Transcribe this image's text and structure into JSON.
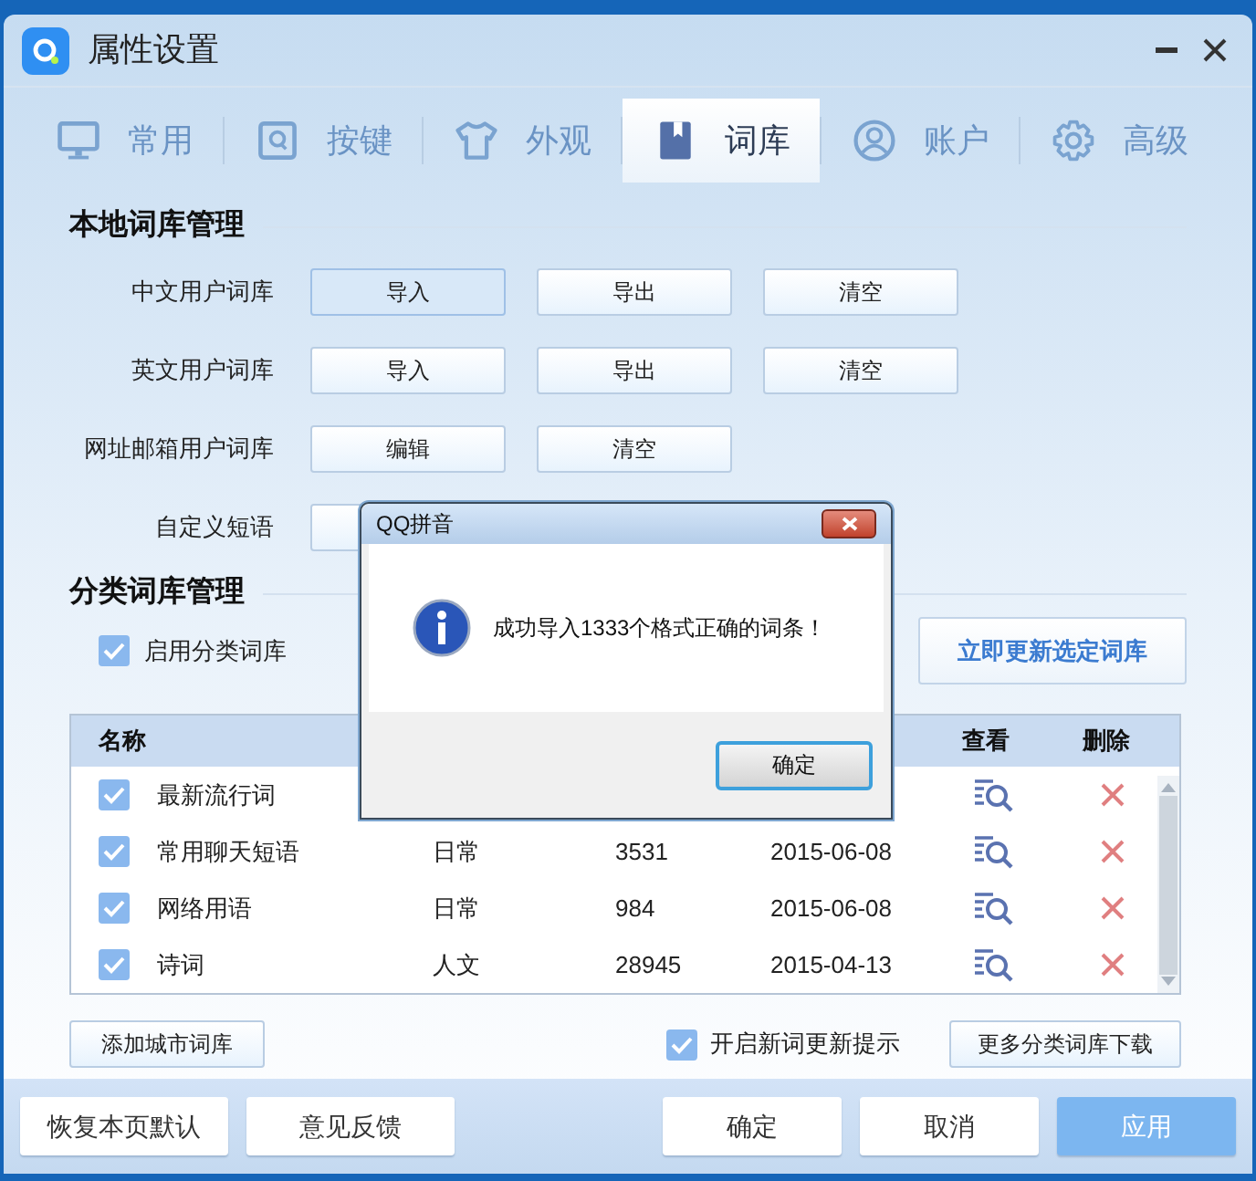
{
  "window": {
    "title": "属性设置"
  },
  "tabs": [
    {
      "label": "常用",
      "selected": false
    },
    {
      "label": "按键",
      "selected": false
    },
    {
      "label": "外观",
      "selected": false
    },
    {
      "label": "词库",
      "selected": true
    },
    {
      "label": "账户",
      "selected": false
    },
    {
      "label": "高级",
      "selected": false
    }
  ],
  "local_dictionaries": {
    "title": "本地词库管理",
    "rows": [
      {
        "label": "中文用户词库",
        "buttons": [
          {
            "label": "导入",
            "selected": true
          },
          {
            "label": "导出",
            "selected": false
          },
          {
            "label": "清空",
            "selected": false
          }
        ]
      },
      {
        "label": "英文用户词库",
        "buttons": [
          {
            "label": "导入",
            "selected": false
          },
          {
            "label": "导出",
            "selected": false
          },
          {
            "label": "清空",
            "selected": false
          }
        ]
      },
      {
        "label": "网址邮箱用户词库",
        "buttons": [
          {
            "label": "编辑",
            "selected": false
          },
          {
            "label": "清空",
            "selected": false
          }
        ]
      },
      {
        "label": "自定义短语",
        "covered_button": true
      }
    ]
  },
  "category_dictionaries": {
    "title": "分类词库管理",
    "enable_checkbox": {
      "label": "启用分类词库",
      "checked": true
    },
    "update_button": "立即更新选定词库",
    "table": {
      "columns": {
        "name": "名称",
        "view": "查看",
        "delete": "删除"
      },
      "rows": [
        {
          "checked": true,
          "name": "最新流行词"
        },
        {
          "checked": true,
          "name": "常用聊天短语",
          "category": "日常",
          "count": "3531",
          "date": "2015-06-08"
        },
        {
          "checked": true,
          "name": "网络用语",
          "category": "日常",
          "count": "984",
          "date": "2015-06-08"
        },
        {
          "checked": true,
          "name": "诗词",
          "category": "人文",
          "count": "28945",
          "date": "2015-04-13"
        }
      ]
    },
    "add_city_button": "添加城市词库",
    "new_word_tip": {
      "label": "开启新词更新提示",
      "checked": true
    },
    "more_download_button": "更多分类词库下载"
  },
  "footer_buttons": [
    {
      "label": "恢复本页默认",
      "kind": "normal"
    },
    {
      "label": "意见反馈",
      "kind": "normal"
    },
    {
      "label": "确定",
      "kind": "normal"
    },
    {
      "label": "取消",
      "kind": "normal"
    },
    {
      "label": "应用",
      "kind": "primary"
    }
  ],
  "dialog": {
    "title": "QQ拼音",
    "message": "成功导入1333个格式正确的词条！",
    "ok_button": "确定"
  }
}
